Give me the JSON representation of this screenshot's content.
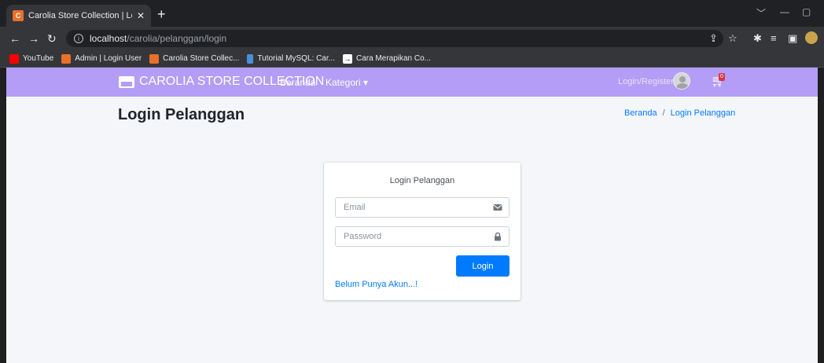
{
  "browser": {
    "tab_title": "Carolia Store Collection | Login P",
    "new_tab": "+",
    "url_host": "localhost",
    "url_path": "/carolia/pelanggan/login",
    "bookmarks": [
      {
        "label": "YouTube",
        "color": "#ff0000"
      },
      {
        "label": "Admin | Login User",
        "color": "#e8702a"
      },
      {
        "label": "Carolia Store Collec...",
        "color": "#e8702a"
      },
      {
        "label": "Tutorial MySQL: Car...",
        "color": "#4a90d9"
      },
      {
        "label": "Cara Merapikan Co...",
        "color": "#1f1f1f"
      }
    ]
  },
  "navbar": {
    "brand": "CAROLIA STORE COLLECTION",
    "links": {
      "beranda": "Beranda",
      "kategori": "Kategori ▾"
    },
    "login_register": "Login/Register",
    "cart_count": "0",
    "bg_color": "#b39df6"
  },
  "header": {
    "title": "Login Pelanggan",
    "breadcrumb": {
      "home": "Beranda",
      "separator": "/",
      "current": "Login Pelanggan"
    }
  },
  "login_card": {
    "message": "Login Pelanggan",
    "email_placeholder": "Email",
    "email_icon": "envelope-icon",
    "password_placeholder": "Password",
    "password_icon": "lock-icon",
    "submit_label": "Login",
    "register_link": "Belum Punya Akun...!"
  }
}
